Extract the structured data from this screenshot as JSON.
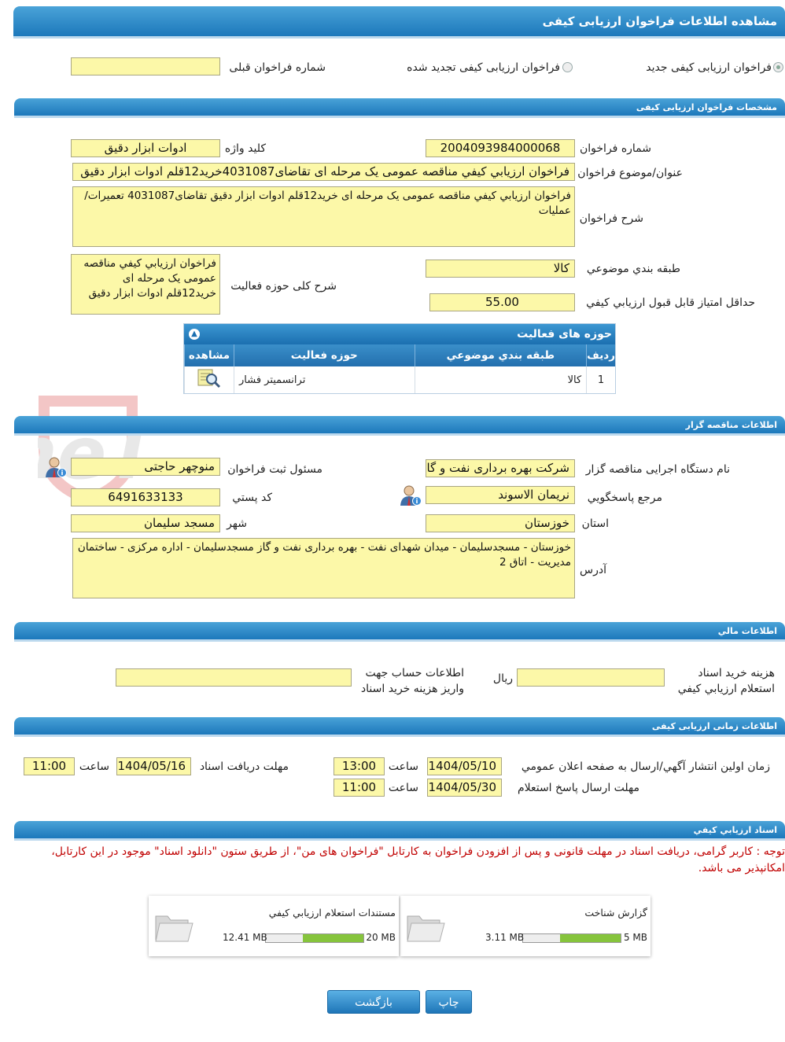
{
  "page_title": "مشاهده اطلاعات فراخوان ارزیابی کیفی",
  "type_options": {
    "new_label": "فراخوان ارزیابی کیفی جدید",
    "renewed_label": "فراخوان ارزیابی کیفی تجدید شده",
    "previous_number_label": "شماره فراخوان قبلی",
    "previous_number_value": ""
  },
  "spec": {
    "section_title": "مشخصات فراخوان ارزیابی کیفی",
    "number_label": "شماره فراخوان",
    "number_value": "2004093984000068",
    "keyword_label": "کلید واژه",
    "keyword_value": "ادوات ابزار دقیق",
    "subject_label": "عنوان/موضوع فراخوان",
    "subject_value": "فراخوان ارزيابي كيفي  مناقصه عمومی یک مرحله ای تقاضای4031087خرید12قلم ادوات ابزار دقیق",
    "desc_label": "شرح فراخوان",
    "desc_value": "فراخوان ارزيابي كيفي مناقصه عمومی یک مرحله ای خرید12قلم ادوات ابزار دقیق تقاضای4031087 تعمیرات/عملیات",
    "category_label": "طبقه بندي موضوعي",
    "category_value": "کالا",
    "activity_desc_label": "شرح کلی حوزه فعالیت",
    "activity_desc_value": "فراخوان ارزيابي كيفي مناقصه عمومی یک مرحله ای خرید12قلم ادوات ابزار دقیق",
    "min_score_label": "حداقل امتياز قابل قبول ارزيابي کيفي",
    "min_score_value": "55.00"
  },
  "activity_grid": {
    "title": "حوزه های فعالیت",
    "columns": [
      "رديف",
      "طبقه بندي موضوعي",
      "حوزه فعالیت",
      "مشاهده"
    ],
    "rows": [
      {
        "index": "1",
        "category": "کالا",
        "activity": "ترانسمیتر فشار"
      }
    ]
  },
  "tenderer": {
    "section_title": "اطلاعات مناقصه گزار",
    "org_label": "نام دستگاه اجرایی مناقصه گزار",
    "org_value": "شرکت بهره برداری نفت و گاز مسجدسلیمان",
    "registrar_label": "مسئول ثبت فراخوان",
    "registrar_value": "منوچهر حاجتی",
    "reference_label": "مرجع پاسخگويي",
    "reference_value": "نریمان الاسوند",
    "postal_label": "کد پستي",
    "postal_value": "6491633133",
    "province_label": "استان",
    "province_value": "خوزستان",
    "city_label": "شهر",
    "city_value": "مسجد سلیمان",
    "address_label": "آدرس",
    "address_value": "خوزستان - مسجدسلیمان - میدان شهدای نفت - بهره برداری نفت و گاز مسجدسلیمان - اداره مرکزی - ساختمان مدیریت - اتاق 2"
  },
  "finance": {
    "section_title": "اطلاعات مالي",
    "fee_label": "هزينه خريد اسناد استعلام ارزيابي کيفي",
    "fee_value": "",
    "currency": "ريال",
    "account_label": "اطلاعات حساب جهت واريز هزينه خريد اسناد",
    "account_value": ""
  },
  "timing": {
    "section_title": "اطلاعات زمانی ارزیابی کیفی",
    "publish_label": "زمان اولين انتشار آگهي/ارسال به صفحه اعلان عمومي",
    "publish_date": "1404/05/10",
    "publish_time": "13:00",
    "receive_label": "مهلت دريافت اسناد",
    "receive_date": "1404/05/16",
    "receive_time": "11:00",
    "reply_label": "مهلت ارسال پاسخ استعلام",
    "reply_date": "1404/05/30",
    "reply_time": "11:00",
    "time_label": "ساعت"
  },
  "documents": {
    "section_title": "اسناد ارزيابي كيفي",
    "note_line1": "توجه : کاربر گرامی، دریافت اسناد در مهلت قانونی و پس از افزودن فراخوان به کارتابل \"فراخوان های من\"، از طریق ستون \"دانلود اسناد\" موجود در این کارتابل،",
    "note_line2": "امکانپذیر می باشد.",
    "items": [
      {
        "title": "گزارش شناخت",
        "size": "3.11 MB",
        "max": "5 MB",
        "fill_fraction": 0.62
      },
      {
        "title": "مستندات استعلام ارزيابي کيفي",
        "size": "12.41 MB",
        "max": "20 MB",
        "fill_fraction": 0.62
      }
    ]
  },
  "buttons": {
    "print": "چاپ",
    "back": "بازگشت"
  },
  "watermark": "AriaTender.neT"
}
